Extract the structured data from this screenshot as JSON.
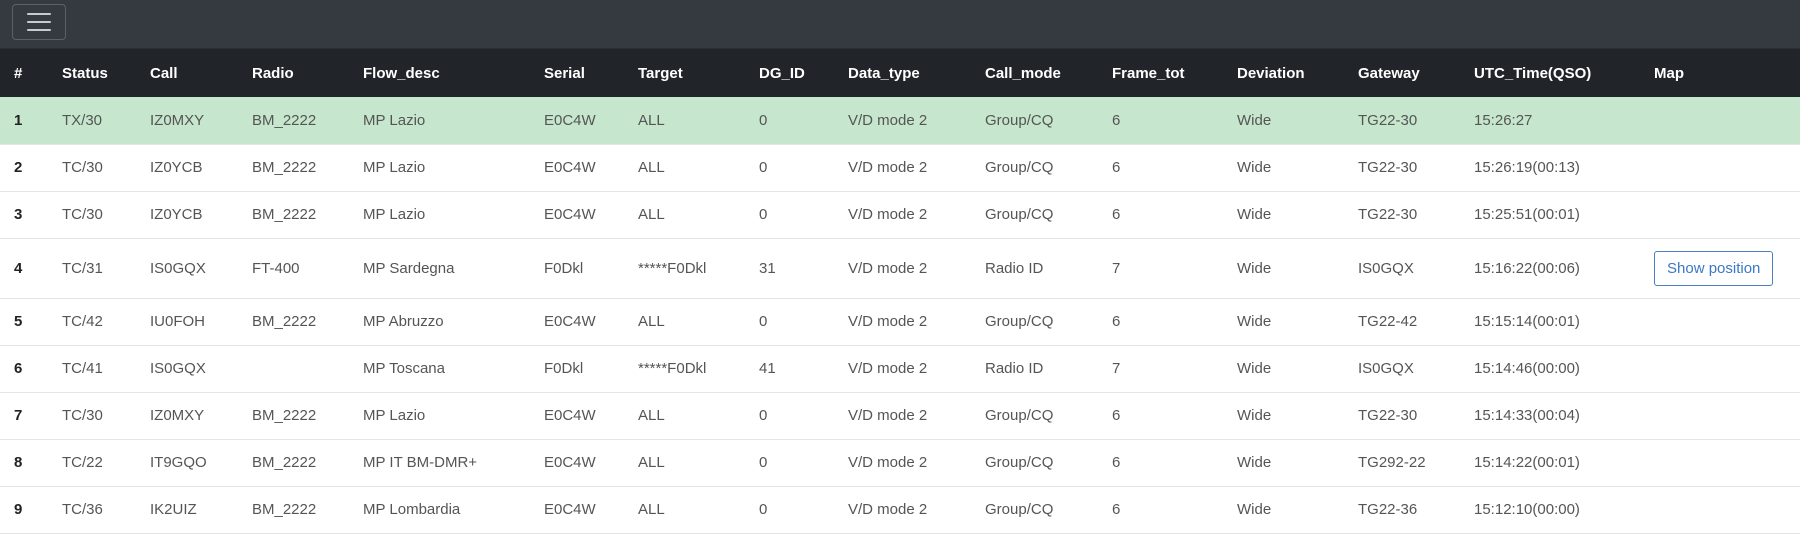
{
  "table": {
    "headers": [
      "#",
      "Status",
      "Call",
      "Radio",
      "Flow_desc",
      "Serial",
      "Target",
      "DG_ID",
      "Data_type",
      "Call_mode",
      "Frame_tot",
      "Deviation",
      "Gateway",
      "UTC_Time(QSO)",
      "Map"
    ],
    "rows": [
      {
        "n": "1",
        "status": "TX/30",
        "call": "IZ0MXY",
        "radio": "BM_2222",
        "flow": "MP Lazio",
        "serial": "E0C4W",
        "target": "ALL",
        "dgid": "0",
        "dtype": "V/D mode 2",
        "cmode": "Group/CQ",
        "frames": "6",
        "dev": "Wide",
        "gw": "TG22-30",
        "utc": "15:26:27",
        "map": ""
      },
      {
        "n": "2",
        "status": "TC/30",
        "call": "IZ0YCB",
        "radio": "BM_2222",
        "flow": "MP Lazio",
        "serial": "E0C4W",
        "target": "ALL",
        "dgid": "0",
        "dtype": "V/D mode 2",
        "cmode": "Group/CQ",
        "frames": "6",
        "dev": "Wide",
        "gw": "TG22-30",
        "utc": "15:26:19(00:13)",
        "map": ""
      },
      {
        "n": "3",
        "status": "TC/30",
        "call": "IZ0YCB",
        "radio": "BM_2222",
        "flow": "MP Lazio",
        "serial": "E0C4W",
        "target": "ALL",
        "dgid": "0",
        "dtype": "V/D mode 2",
        "cmode": "Group/CQ",
        "frames": "6",
        "dev": "Wide",
        "gw": "TG22-30",
        "utc": "15:25:51(00:01)",
        "map": ""
      },
      {
        "n": "4",
        "status": "TC/31",
        "call": "IS0GQX",
        "radio": "FT-400",
        "flow": "MP Sardegna",
        "serial": "F0Dkl",
        "target": "*****F0Dkl",
        "dgid": "31",
        "dtype": "V/D mode 2",
        "cmode": "Radio ID",
        "frames": "7",
        "dev": "Wide",
        "gw": "IS0GQX",
        "utc": "15:16:22(00:06)",
        "map": "Show position"
      },
      {
        "n": "5",
        "status": "TC/42",
        "call": "IU0FOH",
        "radio": "BM_2222",
        "flow": "MP Abruzzo",
        "serial": "E0C4W",
        "target": "ALL",
        "dgid": "0",
        "dtype": "V/D mode 2",
        "cmode": "Group/CQ",
        "frames": "6",
        "dev": "Wide",
        "gw": "TG22-42",
        "utc": "15:15:14(00:01)",
        "map": ""
      },
      {
        "n": "6",
        "status": "TC/41",
        "call": "IS0GQX",
        "radio": "",
        "flow": "MP Toscana",
        "serial": "F0Dkl",
        "target": "*****F0Dkl",
        "dgid": "41",
        "dtype": "V/D mode 2",
        "cmode": "Radio ID",
        "frames": "7",
        "dev": "Wide",
        "gw": "IS0GQX",
        "utc": "15:14:46(00:00)",
        "map": ""
      },
      {
        "n": "7",
        "status": "TC/30",
        "call": "IZ0MXY",
        "radio": "BM_2222",
        "flow": "MP Lazio",
        "serial": "E0C4W",
        "target": "ALL",
        "dgid": "0",
        "dtype": "V/D mode 2",
        "cmode": "Group/CQ",
        "frames": "6",
        "dev": "Wide",
        "gw": "TG22-30",
        "utc": "15:14:33(00:04)",
        "map": ""
      },
      {
        "n": "8",
        "status": "TC/22",
        "call": "IT9GQO",
        "radio": "BM_2222",
        "flow": "MP IT BM-DMR+",
        "serial": "E0C4W",
        "target": "ALL",
        "dgid": "0",
        "dtype": "V/D mode 2",
        "cmode": "Group/CQ",
        "frames": "6",
        "dev": "Wide",
        "gw": "TG292-22",
        "utc": "15:14:22(00:01)",
        "map": ""
      },
      {
        "n": "9",
        "status": "TC/36",
        "call": "IK2UIZ",
        "radio": "BM_2222",
        "flow": "MP Lombardia",
        "serial": "E0C4W",
        "target": "ALL",
        "dgid": "0",
        "dtype": "V/D mode 2",
        "cmode": "Group/CQ",
        "frames": "6",
        "dev": "Wide",
        "gw": "TG22-36",
        "utc": "15:12:10(00:00)",
        "map": ""
      }
    ]
  },
  "colors": {
    "header_bg": "#212529",
    "topbar_bg": "#343a40",
    "highlight_row": "#c6e6cd",
    "link_button": "#3c78c4"
  },
  "icons": {
    "menu": "hamburger-menu-icon"
  }
}
